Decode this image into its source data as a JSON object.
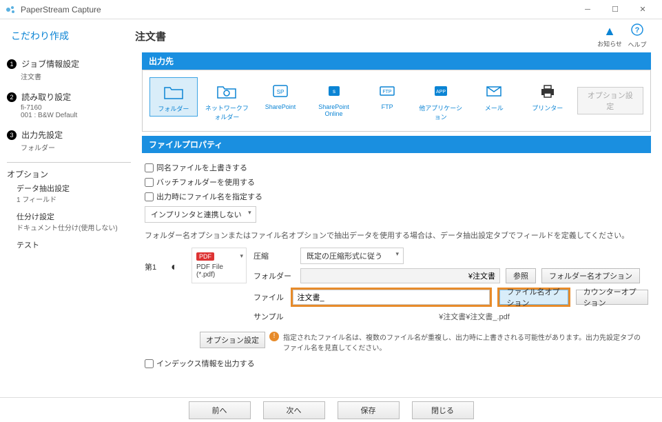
{
  "app": {
    "title": "PaperStream Capture"
  },
  "header": {
    "mode": "こだわり作成",
    "job_title": "注文書",
    "notify_label": "お知らせ",
    "help_label": "ヘルプ"
  },
  "sidebar": {
    "steps": [
      {
        "label": "ジョブ情報設定",
        "sub": "注文書"
      },
      {
        "label": "読み取り設定",
        "sub": "fi-7160\n001 : B&W Default"
      },
      {
        "label": "出力先設定",
        "sub": "フォルダー"
      }
    ],
    "options_title": "オプション",
    "options": [
      {
        "label": "データ抽出設定",
        "sub": "1 フィールド"
      },
      {
        "label": "仕分け設定",
        "sub": "ドキュメント仕分け(使用しない)"
      },
      {
        "label": "テスト",
        "sub": ""
      }
    ]
  },
  "dest": {
    "section": "出力先",
    "items": [
      {
        "label": "フォルダー"
      },
      {
        "label": "ネットワークフォルダー"
      },
      {
        "label": "SharePoint"
      },
      {
        "label": "SharePoint Online"
      },
      {
        "label": "FTP"
      },
      {
        "label": "他アプリケーション"
      },
      {
        "label": "メール"
      },
      {
        "label": "プリンター"
      }
    ],
    "option_btn": "オプション設定"
  },
  "fileprop": {
    "section": "ファイルプロパティ",
    "chk_overwrite": "同名ファイルを上書きする",
    "chk_batch_folder": "バッチフォルダーを使用する",
    "chk_specify_name": "出力時にファイル名を指定する",
    "imprinter_sel": "インプリンタと連携しない",
    "note": "フォルダー名オプションまたはファイル名オプションで抽出データを使用する場合は、データ抽出設定タブでフィールドを定義してください。",
    "idx_label": "第1",
    "pdf": {
      "badge": "PDF",
      "type": "PDF File (*.pdf)"
    },
    "rows": {
      "compress_label": "圧縮",
      "compress_value": "既定の圧縮形式に従う",
      "folder_label": "フォルダー",
      "folder_value": "¥注文書",
      "browse_btn": "参照",
      "folder_opt_btn": "フォルダー名オプション",
      "file_label": "ファイル",
      "file_value": "注文書_",
      "file_opt_btn": "ファイル名オプション",
      "counter_btn": "カウンターオプション",
      "sample_label": "サンプル",
      "sample_value": "¥注文書¥注文書_.pdf"
    },
    "warn": {
      "btn": "オプション設定",
      "text": "指定されたファイル名は、複数のファイル名が重複し、出力時に上書きされる可能性があります。出力先設定タブのファイル名を見直してください。"
    },
    "chk_index_out": "インデックス情報を出力する"
  },
  "bottom": {
    "prev": "前へ",
    "next": "次へ",
    "save": "保存",
    "close": "閉じる"
  }
}
